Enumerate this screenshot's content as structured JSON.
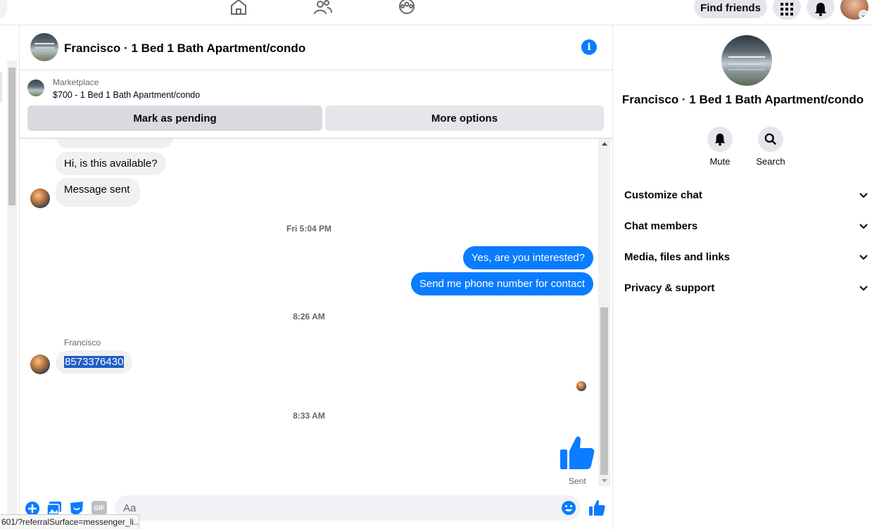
{
  "topbar": {
    "find_friends_label": "Find friends"
  },
  "conversation": {
    "title": "Francisco · 1 Bed 1 Bath Apartment/condo"
  },
  "marketplace": {
    "label": "Marketplace",
    "listing": "$700 - 1 Bed 1 Bath Apartment/condo",
    "mark_pending_label": "Mark as pending",
    "more_options_label": "More options"
  },
  "messages": {
    "in_1": "Hi, is this available?",
    "in_2": "Message sent",
    "ts_1": "Fri 5:04 PM",
    "out_1": "Yes, are you interested?",
    "out_2": "Send me phone number for contact",
    "ts_2": "8:26 AM",
    "sender": "Francisco",
    "in_3": "8573376430",
    "ts_3": "8:33 AM",
    "sent_status": "Sent"
  },
  "composer": {
    "placeholder": "Aa",
    "gif_label": "GIF"
  },
  "status_bar": {
    "url": "601/?referralSurface=messenger_li..."
  },
  "details": {
    "title": "Francisco · 1 Bed 1 Bath Apartment/condo",
    "mute_label": "Mute",
    "search_label": "Search",
    "sections": [
      "Customize chat",
      "Chat members",
      "Media, files and links",
      "Privacy & support"
    ]
  },
  "colors": {
    "accent": "#0a7cff",
    "bubble_in": "#f0f0f0",
    "button_gray": "#e4e6eb"
  }
}
